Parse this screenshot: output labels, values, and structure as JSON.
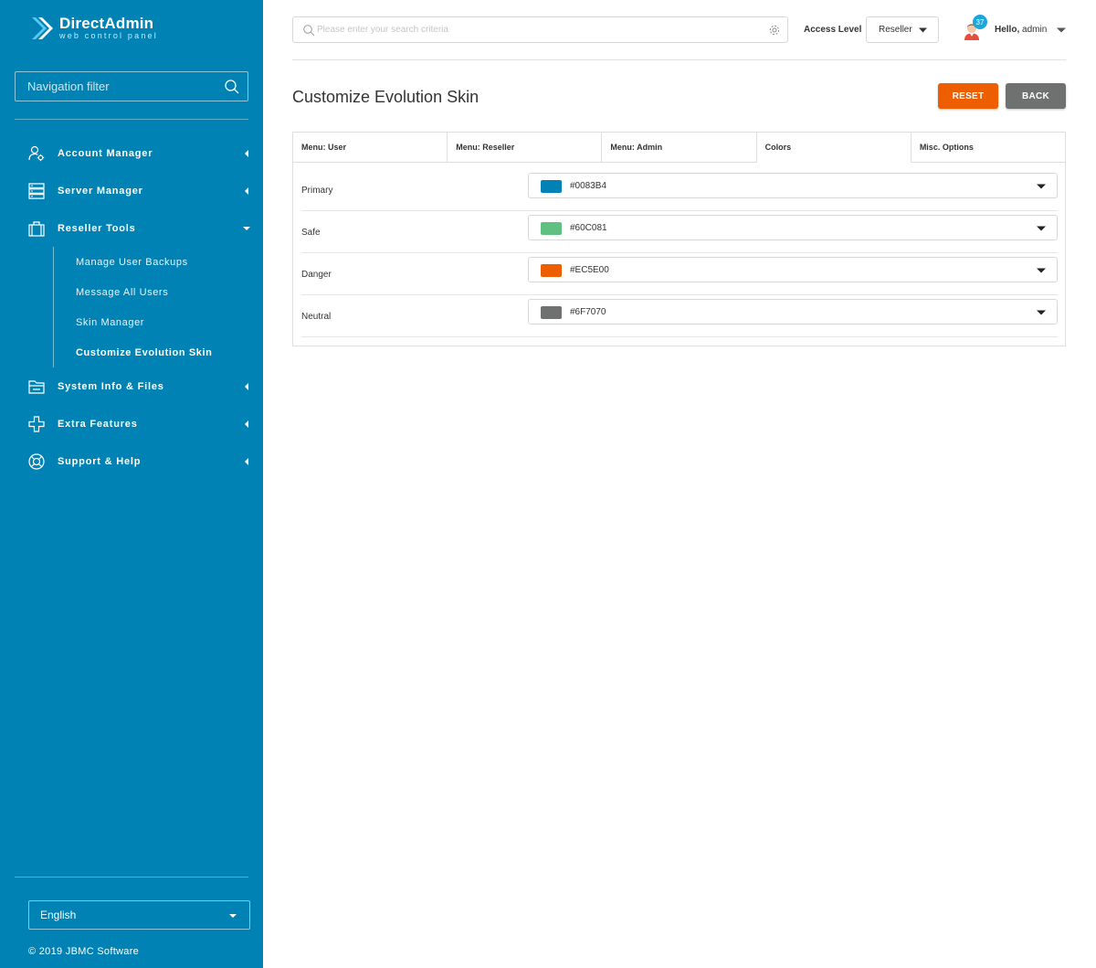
{
  "brand": {
    "name": "DirectAdmin",
    "tagline": "web control panel"
  },
  "sidebar": {
    "filter_placeholder": "Navigation filter",
    "items": [
      {
        "label": "Account Manager"
      },
      {
        "label": "Server Manager"
      },
      {
        "label": "Reseller Tools"
      },
      {
        "label": "System Info & Files"
      },
      {
        "label": "Extra Features"
      },
      {
        "label": "Support & Help"
      }
    ],
    "sub_items": [
      {
        "label": "Manage User Backups"
      },
      {
        "label": "Message All Users"
      },
      {
        "label": "Skin Manager"
      },
      {
        "label": "Customize Evolution Skin"
      }
    ],
    "language": "English",
    "copyright": "© 2019 JBMC Software"
  },
  "topbar": {
    "search_placeholder": "Please enter your search criteria",
    "access_label": "Access Level",
    "access_value": "Reseller",
    "notifications": "37",
    "hello_prefix": "Hello,",
    "user": "admin"
  },
  "page": {
    "title": "Customize Evolution Skin",
    "reset_label": "RESET",
    "back_label": "BACK",
    "tabs": [
      {
        "label": "Menu: User"
      },
      {
        "label": "Menu: Reseller"
      },
      {
        "label": "Menu: Admin"
      },
      {
        "label": "Colors"
      },
      {
        "label": "Misc. Options"
      }
    ],
    "colors": [
      {
        "label": "Primary",
        "value": "#0083B4"
      },
      {
        "label": "Safe",
        "value": "#60C081"
      },
      {
        "label": "Danger",
        "value": "#EC5E00"
      },
      {
        "label": "Neutral",
        "value": "#6F7070"
      }
    ]
  },
  "theme": {
    "sidebar_bg": "#0083B4",
    "reset_bg": "#EC5E00",
    "back_bg": "#6F7070",
    "badge_bg": "#1CA6DC"
  }
}
